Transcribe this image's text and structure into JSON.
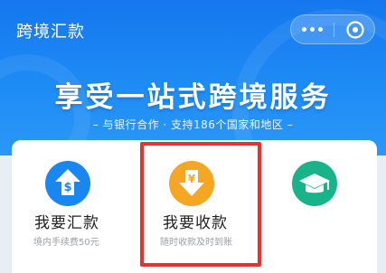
{
  "app": {
    "title": "跨境汇款"
  },
  "capsule": {
    "more_label": "更多",
    "close_label": "关闭"
  },
  "banner": {
    "headline": "享受一站式跨境服务",
    "subline": "– 与银行合作 · 支持186个国家和地区 –"
  },
  "services": [
    {
      "label": "我要汇款",
      "desc": "境内手续费50元",
      "icon": "dollar-upload-icon",
      "color": "#1a86f0"
    },
    {
      "label": "我要收款",
      "desc": "随时收款及时到账",
      "icon": "yuan-download-icon",
      "color": "#f5a623"
    },
    {
      "label": "",
      "desc": "",
      "icon": "graduation-cap-icon",
      "color": "#19b38a"
    }
  ],
  "colors": {
    "banner": "#1a86f0",
    "highlight": "#e5332f"
  }
}
